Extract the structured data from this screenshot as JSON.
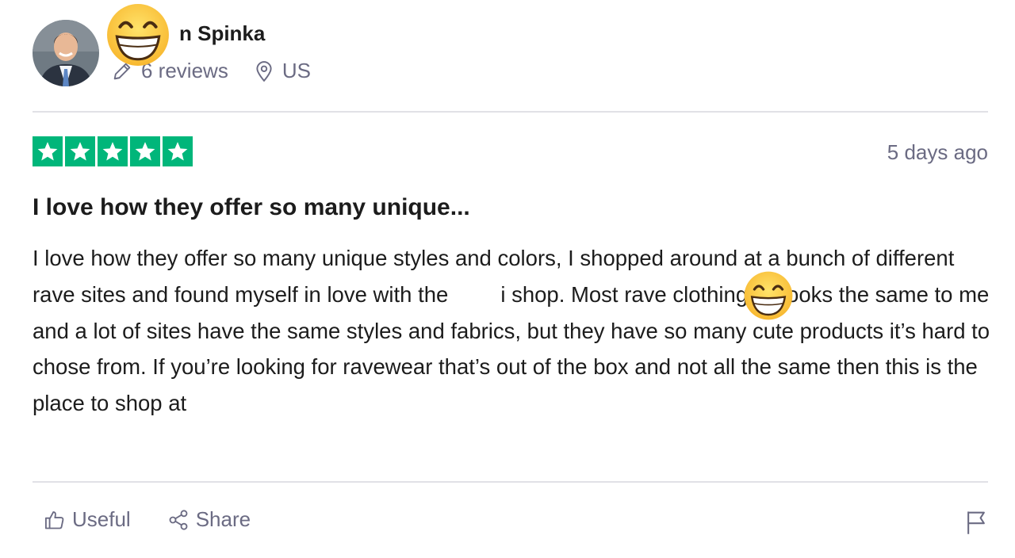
{
  "reviewer": {
    "name": "n Spinka",
    "reviews_count": "6 reviews",
    "location": "US"
  },
  "review": {
    "rating": 5,
    "date": "5 days ago",
    "title": "I love how they offer so many unique...",
    "body": "I love how they offer so many unique styles and colors, I shopped around at a bunch of different rave sites and found myself in love with the",
    "body_cont": "i shop. Most rave clothing all looks the same to me and a lot of sites have the same styles and fabrics, but they have so many cute products it’s hard to chose from. If you’re looking for ravewear that’s out of the box and not all the same then this is the place to shop at"
  },
  "actions": {
    "useful_label": "Useful",
    "share_label": "Share"
  },
  "icons": {
    "reviews": "pencil-icon",
    "location": "location-pin-icon",
    "useful": "thumbs-up-icon",
    "share": "share-icon",
    "report": "flag-icon",
    "overlay": "grinning-emoji"
  },
  "colors": {
    "star_green": "#00b67a",
    "muted_text": "#6b6b83",
    "divider": "#e1e1e6",
    "emoji_yellow": "#ffd23c"
  }
}
